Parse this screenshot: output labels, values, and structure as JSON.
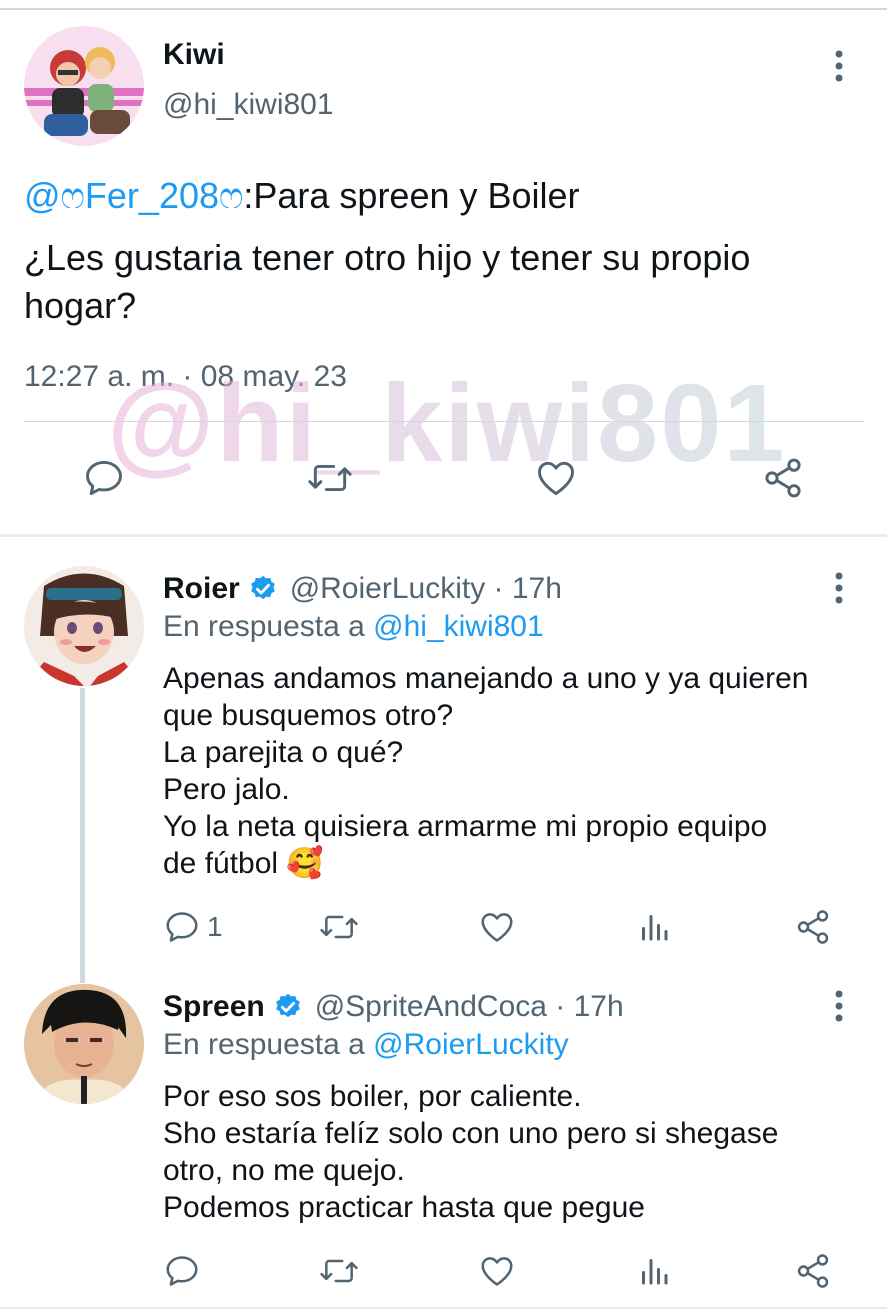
{
  "tweet": {
    "author_name": "Kiwi",
    "author_handle": "@hi_kiwi801",
    "quote_mention": "@ෆFer_208ෆ",
    "quote_rest": ":Para spreen y Boiler",
    "question": "¿Les gustaria tener otro hijo y tener su propio hogar?",
    "timestamp": "12:27 a. m. · 08 may. 23",
    "watermark": "@hi_kiwi801"
  },
  "replies": [
    {
      "name": "Roier",
      "handle": "@RoierLuckity · 17h",
      "reply_prefix": "En respuesta a ",
      "reply_mention": "@hi_kiwi801",
      "lines": [
        "Apenas andamos manejando a uno y ya quieren",
        "que busquemos otro?",
        "La parejita o qué?",
        "Pero jalo.",
        "Yo la neta quisiera armarme mi propio equipo",
        "de fútbol 🥰"
      ],
      "reply_count": "1"
    },
    {
      "name": "Spreen",
      "handle": "@SpriteAndCoca · 17h",
      "reply_prefix": "En respuesta a ",
      "reply_mention": "@RoierLuckity",
      "lines": [
        "Por eso sos boiler, por caliente.",
        "Sho estaría felíz solo con uno pero si shegase",
        "otro, no me quejo.",
        "Podemos practicar hasta que pegue"
      ],
      "reply_count": ""
    }
  ],
  "icons": {
    "reply": "comment-icon",
    "retweet": "retweet-icon",
    "like": "heart-icon",
    "views": "analytics-icon",
    "share": "share-icon",
    "more": "more-vertical-icon",
    "verified": "verified-badge-icon"
  },
  "colors": {
    "accent": "#1d9bf0",
    "secondary_text": "#536471",
    "text": "#0f1419",
    "divider": "#cfd9de"
  }
}
